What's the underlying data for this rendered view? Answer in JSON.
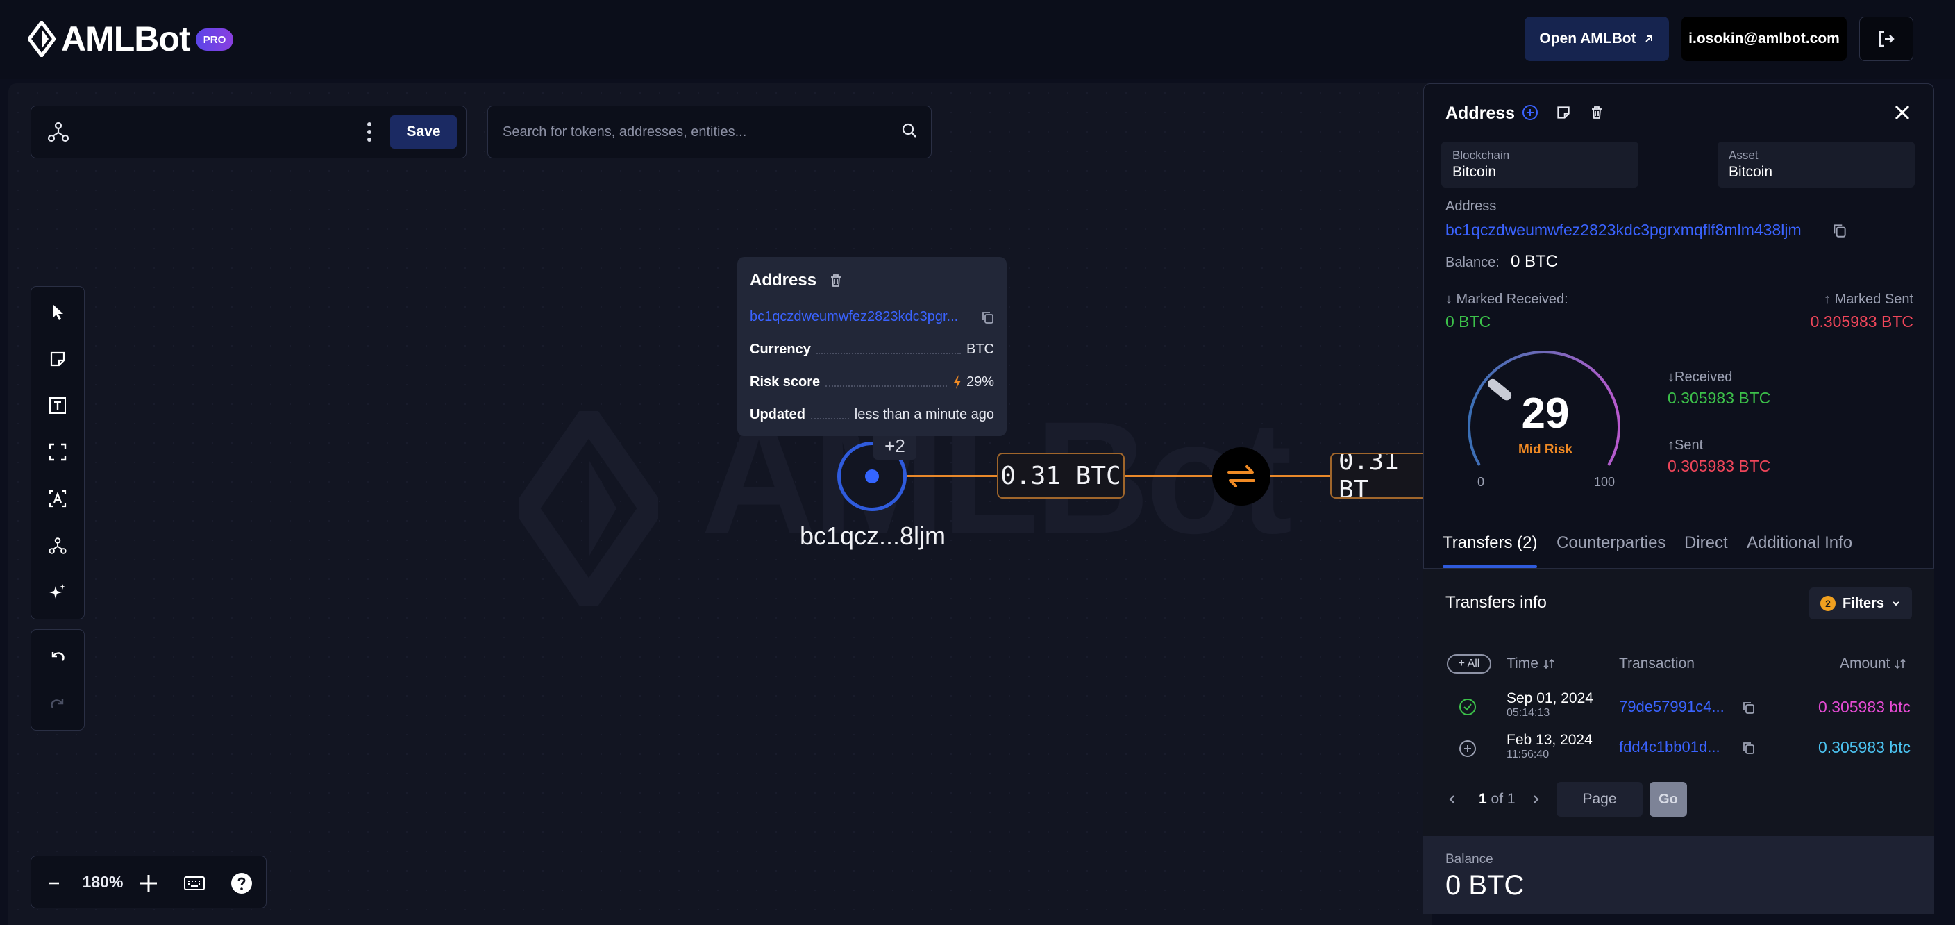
{
  "header": {
    "brand": "AMLBot",
    "pro_badge": "PRO",
    "open_button": "Open AMLBot",
    "user_email": "i.osokin@amlbot.com"
  },
  "toolbar": {
    "save_label": "Save",
    "search_placeholder": "Search for tokens, addresses, entities..."
  },
  "canvas": {
    "watermark": "AMLBot",
    "zoom_level": "180%",
    "node": {
      "label": "bc1qcz...8ljm",
      "extra_count": "+2"
    },
    "edges": [
      {
        "amount": "0.31 BTC"
      },
      {
        "amount": "0.31 BT"
      }
    ]
  },
  "tooltip": {
    "title": "Address",
    "address": "bc1qczdweumwfez2823kdc3pgr...",
    "rows": [
      {
        "key": "Currency",
        "value": "BTC"
      },
      {
        "key": "Risk score",
        "value": "29%"
      },
      {
        "key": "Updated",
        "value": "less than a minute ago"
      }
    ]
  },
  "panel": {
    "title": "Address",
    "blockchain_label": "Blockchain",
    "blockchain_value": "Bitcoin",
    "asset_label": "Asset",
    "asset_value": "Bitcoin",
    "address_label": "Address",
    "address": "bc1qczdweumwfez2823kdc3pgrxmqflf8mlm438ljm",
    "balance_label": "Balance:",
    "balance_value": "0 BTC",
    "marked_received_label": "↓ Marked Received:",
    "marked_received_value": "0 BTC",
    "marked_sent_label": "↑ Marked Sent",
    "marked_sent_value": "0.305983 BTC",
    "received_label": "↓Received",
    "received_value": "0.305983 BTC",
    "sent_label": "↑Sent",
    "sent_value": "0.305983 BTC",
    "risk": {
      "score": "29",
      "level": "Mid Risk",
      "min": "0",
      "max": "100",
      "fraction": 0.29
    },
    "tabs": [
      {
        "label": "Transfers (2)"
      },
      {
        "label": "Counterparties"
      },
      {
        "label": "Direct"
      },
      {
        "label": "Additional Info"
      }
    ],
    "transfers": {
      "title": "Transfers info",
      "filters_label": "Filters",
      "filters_count": "2",
      "all_label": "+ All",
      "columns": {
        "time": "Time",
        "transaction": "Transaction",
        "amount": "Amount"
      },
      "rows": [
        {
          "date": "Sep 01, 2024",
          "time": "05:14:13",
          "hash": "79de57991c4...",
          "amount": "0.305983 btc"
        },
        {
          "date": "Feb 13, 2024",
          "time": "11:56:40",
          "hash": "fdd4c1bb01d...",
          "amount": "0.305983 btc"
        }
      ],
      "pager": {
        "current": "1",
        "of_label": "of 1",
        "page_placeholder": "Page",
        "go_label": "Go"
      }
    },
    "footer_balance_label": "Balance",
    "footer_balance_value": "0 BTC"
  },
  "colors": {
    "accent_blue": "#2f5bdc",
    "link_blue": "#3a63ff",
    "edge_orange": "#e8882a",
    "received_green": "#3cc14a",
    "sent_red": "#f0465a",
    "risk_orange": "#f08a24"
  }
}
